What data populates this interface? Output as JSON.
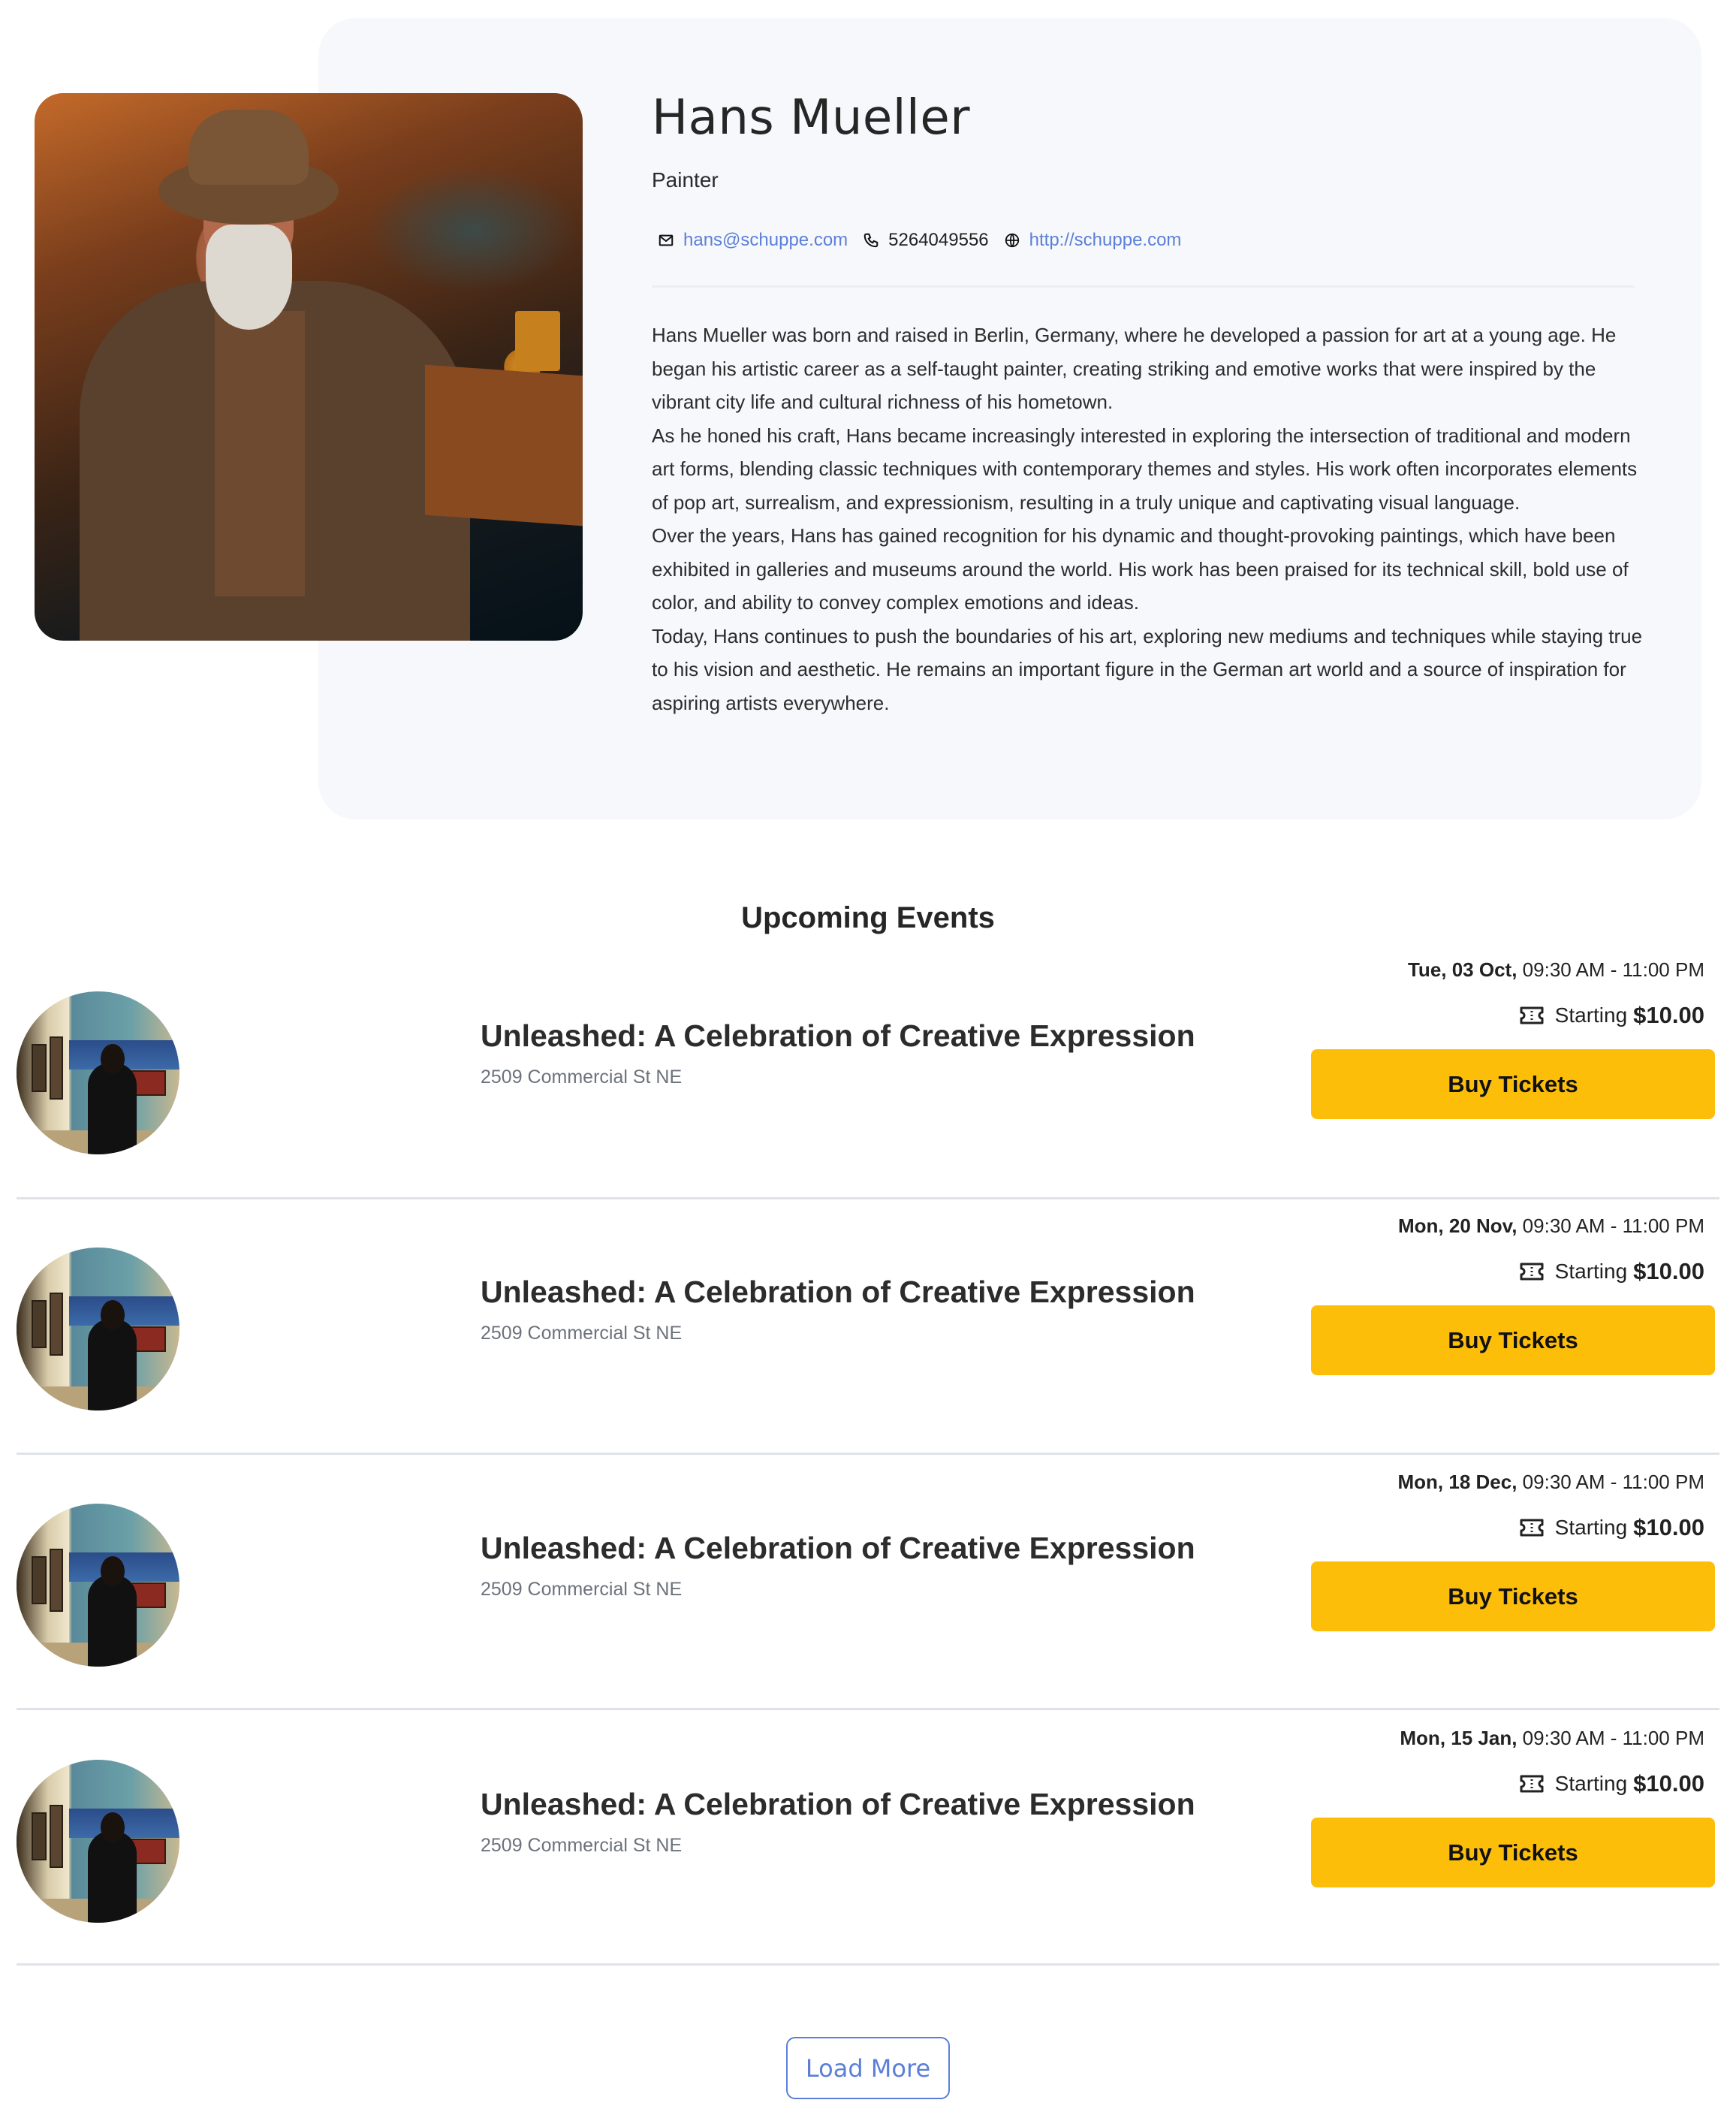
{
  "profile": {
    "name": "Hans Mueller",
    "role": "Painter",
    "email": "hans@schuppe.com",
    "phone": "5264049556",
    "website": "http://schuppe.com",
    "link_color": "#5b7fd8",
    "bio": [
      "Hans Mueller was born and raised in Berlin, Germany, where he developed a passion for art at a young age. He began his artistic career as a self-taught painter, creating striking and emotive works that were inspired by the vibrant city life and cultural richness of his hometown.",
      "As he honed his craft, Hans became increasingly interested in exploring the intersection of traditional and modern art forms, blending classic techniques with contemporary themes and styles. His work often incorporates elements of pop art, surrealism, and expressionism, resulting in a truly unique and captivating visual language.",
      "Over the years, Hans has gained recognition for his dynamic and thought-provoking paintings, which have been exhibited in galleries and museums around the world. His work has been praised for its technical skill, bold use of color, and ability to convey complex emotions and ideas.",
      "Today, Hans continues to push the boundaries of his art, exploring new mediums and techniques while staying true to his vision and aesthetic. He remains an important figure in the German art world and a source of inspiration for aspiring artists everywhere."
    ],
    "icons": {
      "email": "mail-icon",
      "phone": "phone-icon",
      "website": "globe-icon"
    }
  },
  "events_section": {
    "title": "Upcoming Events",
    "events": [
      {
        "title": "Unleashed: A Celebration of Creative Expression",
        "address": "2509 Commercial St NE",
        "date": "Tue, 03 Oct,",
        "time": "09:30 AM - 11:00 PM",
        "price_label": "Starting",
        "price": "$10.00",
        "button": "Buy Tickets"
      },
      {
        "title": "Unleashed: A Celebration of Creative Expression",
        "address": "2509 Commercial St NE",
        "date": "Mon, 20 Nov,",
        "time": "09:30 AM - 11:00 PM",
        "price_label": "Starting",
        "price": "$10.00",
        "button": "Buy Tickets"
      },
      {
        "title": "Unleashed: A Celebration of Creative Expression",
        "address": "2509 Commercial St NE",
        "date": "Mon, 18 Dec,",
        "time": "09:30 AM - 11:00 PM",
        "price_label": "Starting",
        "price": "$10.00",
        "button": "Buy Tickets"
      },
      {
        "title": "Unleashed: A Celebration of Creative Expression",
        "address": "2509 Commercial St NE",
        "date": "Mon, 15 Jan,",
        "time": "09:30 AM - 11:00 PM",
        "price_label": "Starting",
        "price": "$10.00",
        "button": "Buy Tickets"
      }
    ],
    "button_color": "#fdbe09",
    "load_more": "Load More"
  }
}
